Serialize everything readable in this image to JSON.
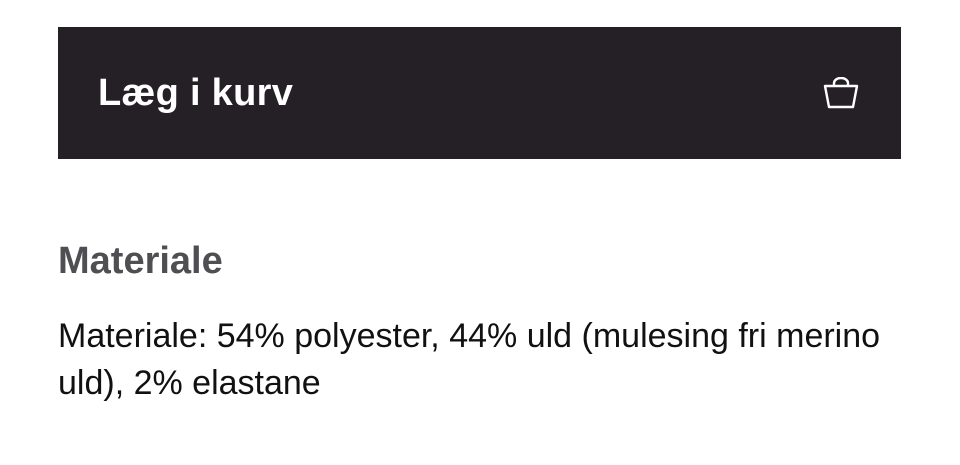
{
  "add_to_cart": {
    "label": "Læg i kurv",
    "icon": "shopping-bag-icon"
  },
  "material_section": {
    "title": "Materiale",
    "text": "Materiale: 54% polyester, 44% uld (mulesing fri merino uld), 2% elastane"
  },
  "colors": {
    "button_bg": "#252026",
    "button_text": "#ffffff",
    "heading": "#4f4f53",
    "body_text": "#111111"
  }
}
